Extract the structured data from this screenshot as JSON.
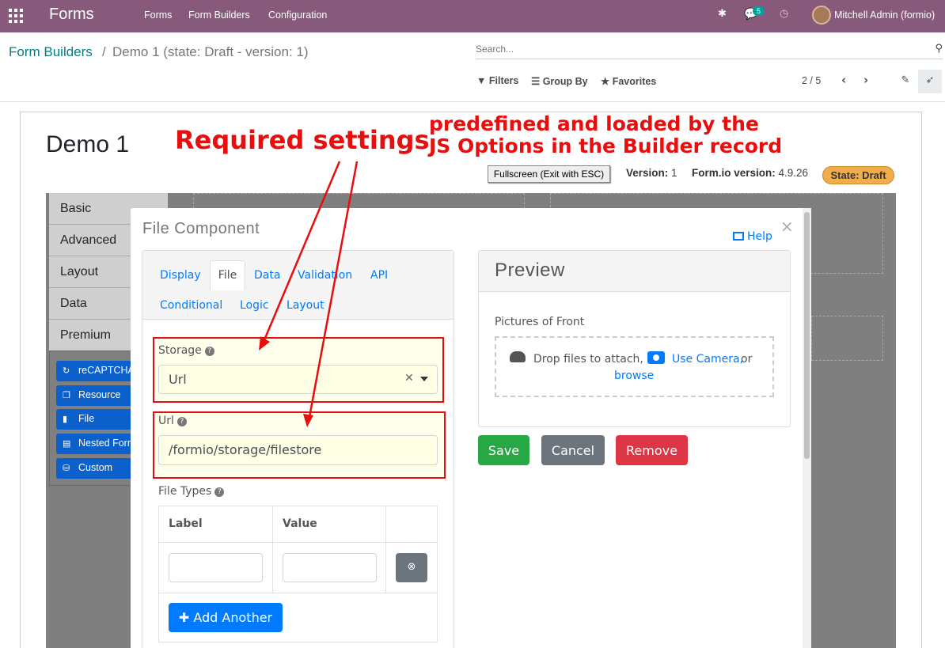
{
  "navbar": {
    "brand": "Forms",
    "menu": [
      "Forms",
      "Form Builders",
      "Configuration"
    ],
    "messages_count": "5",
    "user": "Mitchell Admin (formio)"
  },
  "control_panel": {
    "breadcrumb_parent": "Form Builders",
    "breadcrumb_separator": "/",
    "breadcrumb_current": "Demo 1 (state: Draft - version: 1)",
    "search_placeholder": "Search...",
    "filters_label": "Filters",
    "groupby_label": "Group By",
    "favorites_label": "Favorites",
    "pager": "2 / 5"
  },
  "record": {
    "title": "Demo 1",
    "fullscreen_button": "Fullscreen (Exit with ESC)",
    "version_label": "Version:",
    "version_value": "1",
    "formio_label": "Form.io version:",
    "formio_value": "4.9.26",
    "state_badge": "State: Draft"
  },
  "builder_sidebar": {
    "groups": [
      "Basic",
      "Advanced",
      "Layout",
      "Data",
      "Premium"
    ],
    "premium_items": [
      "reCAPTCHA",
      "Resource",
      "File",
      "Nested Form",
      "Custom"
    ]
  },
  "modal": {
    "title": "File Component",
    "help_label": "Help",
    "close_symbol": "×",
    "tabs": [
      "Display",
      "File",
      "Data",
      "Validation",
      "API",
      "Conditional",
      "Logic",
      "Layout"
    ],
    "active_tab": "File",
    "storage_label": "Storage",
    "storage_value": "Url",
    "url_label": "Url",
    "url_value": "/formio/storage/filestore",
    "file_types_label": "File Types",
    "file_types_columns": [
      "Label",
      "Value"
    ],
    "add_another_label": "Add Another",
    "preview_title": "Preview",
    "preview_field_label": "Pictures of Front",
    "drop_text": "Drop files to attach,",
    "use_camera_label": "Use Camera,",
    "or_text": "or",
    "browse_label": "browse",
    "save_label": "Save",
    "cancel_label": "Cancel",
    "remove_label": "Remove"
  },
  "annotations": {
    "required": "Required settings",
    "predefined_line1": "predefined and loaded by the",
    "predefined_line2": "JS Options in the Builder record"
  },
  "colors": {
    "navbar": "#875a7b",
    "accent_link": "#017e84",
    "annotation_red": "#e80e0e",
    "primary": "#007bff",
    "success": "#28a745",
    "secondary": "#6c757d",
    "danger": "#dc3545",
    "state_badge": "#f0ad4e"
  }
}
